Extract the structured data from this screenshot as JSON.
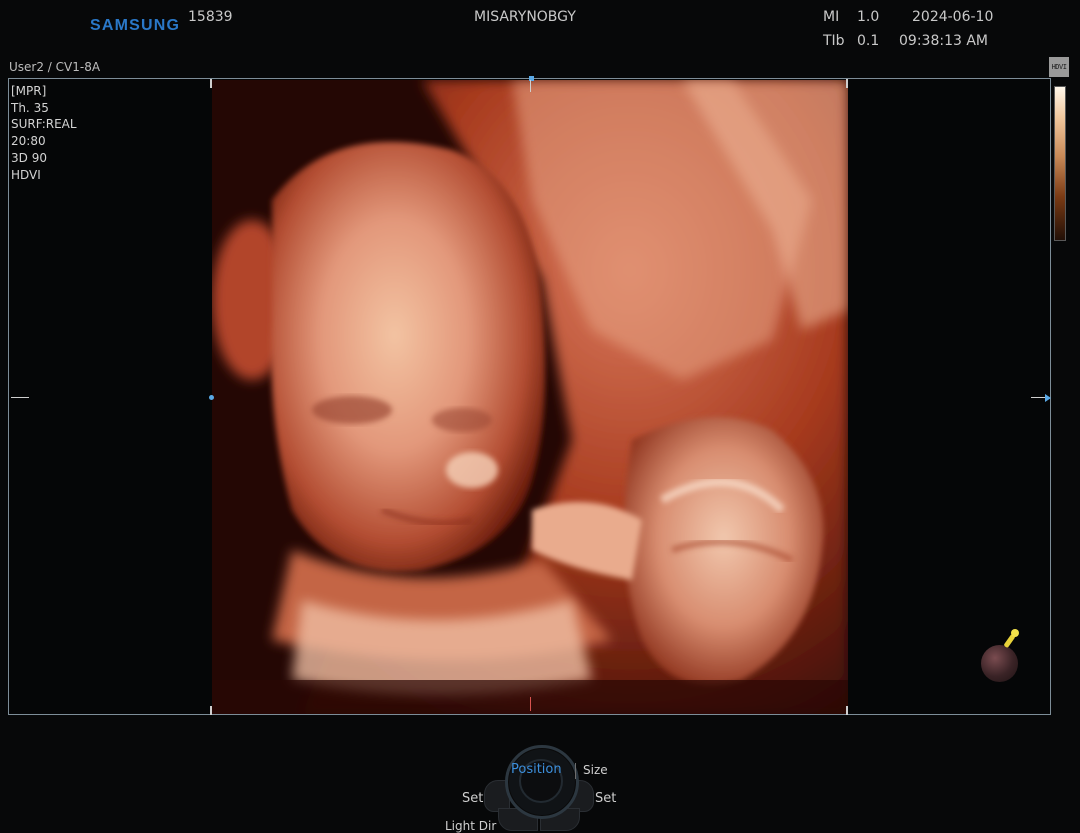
{
  "header": {
    "brand": "SAMSUNG",
    "id_number": "15839",
    "exam_name": "MISARYNOBGY",
    "mi_label": "MI",
    "mi_value": "1.0",
    "tib_label": "TIb",
    "tib_value": "0.1",
    "date": "2024-06-10",
    "time": "09:38:13 AM"
  },
  "subheader": {
    "user_probe": "User2 / CV1-8A"
  },
  "image_info": [
    "[MPR]",
    "Th. 35",
    "SURF:REAL",
    "20:80",
    "3D 90",
    "HDVI"
  ],
  "indicators": {
    "hdvi_icon": "hdvi-icon",
    "colorbar": "grayscale-colormap"
  },
  "dial": {
    "center_label": "Position",
    "right_top_label": "Size",
    "left_label": "Set",
    "right_label": "Set",
    "bottom_left_label": "Light Dir"
  },
  "colors": {
    "brand": "#2a78c8",
    "active_dial": "#3c8fdc",
    "frame": "#7d8d98"
  }
}
